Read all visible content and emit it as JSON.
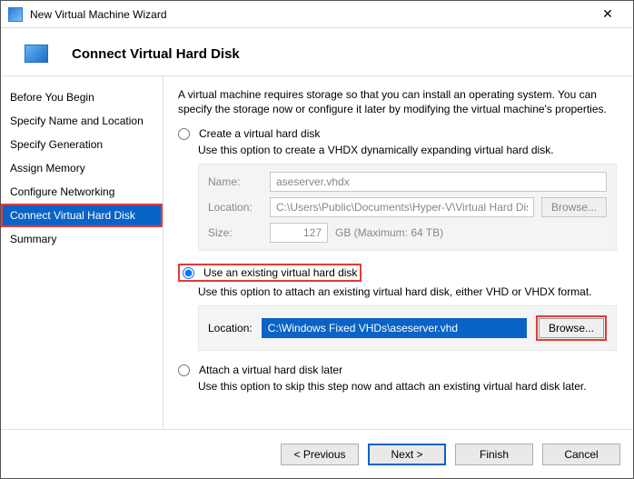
{
  "window": {
    "title": "New Virtual Machine Wizard"
  },
  "header": {
    "title": "Connect Virtual Hard Disk"
  },
  "sidebar": {
    "items": [
      {
        "label": "Before You Begin"
      },
      {
        "label": "Specify Name and Location"
      },
      {
        "label": "Specify Generation"
      },
      {
        "label": "Assign Memory"
      },
      {
        "label": "Configure Networking"
      },
      {
        "label": "Connect Virtual Hard Disk"
      },
      {
        "label": "Summary"
      }
    ],
    "active_index": 5
  },
  "intro": "A virtual machine requires storage so that you can install an operating system. You can specify the storage now or configure it later by modifying the virtual machine's properties.",
  "opt1": {
    "label": "Create a virtual hard disk",
    "desc": "Use this option to create a VHDX dynamically expanding virtual hard disk.",
    "name_label": "Name:",
    "name_value": "aseserver.vhdx",
    "location_label": "Location:",
    "location_value": "C:\\Users\\Public\\Documents\\Hyper-V\\Virtual Hard Disks\\",
    "browse_label": "Browse...",
    "size_label": "Size:",
    "size_value": "127",
    "size_unit": "GB (Maximum: 64 TB)"
  },
  "opt2": {
    "label": "Use an existing virtual hard disk",
    "desc": "Use this option to attach an existing virtual hard disk, either VHD or VHDX format.",
    "location_label": "Location:",
    "location_value": "C:\\Windows Fixed VHDs\\aseserver.vhd",
    "browse_label": "Browse..."
  },
  "opt3": {
    "label": "Attach a virtual hard disk later",
    "desc": "Use this option to skip this step now and attach an existing virtual hard disk later."
  },
  "footer": {
    "previous": "< Previous",
    "next": "Next >",
    "finish": "Finish",
    "cancel": "Cancel"
  }
}
